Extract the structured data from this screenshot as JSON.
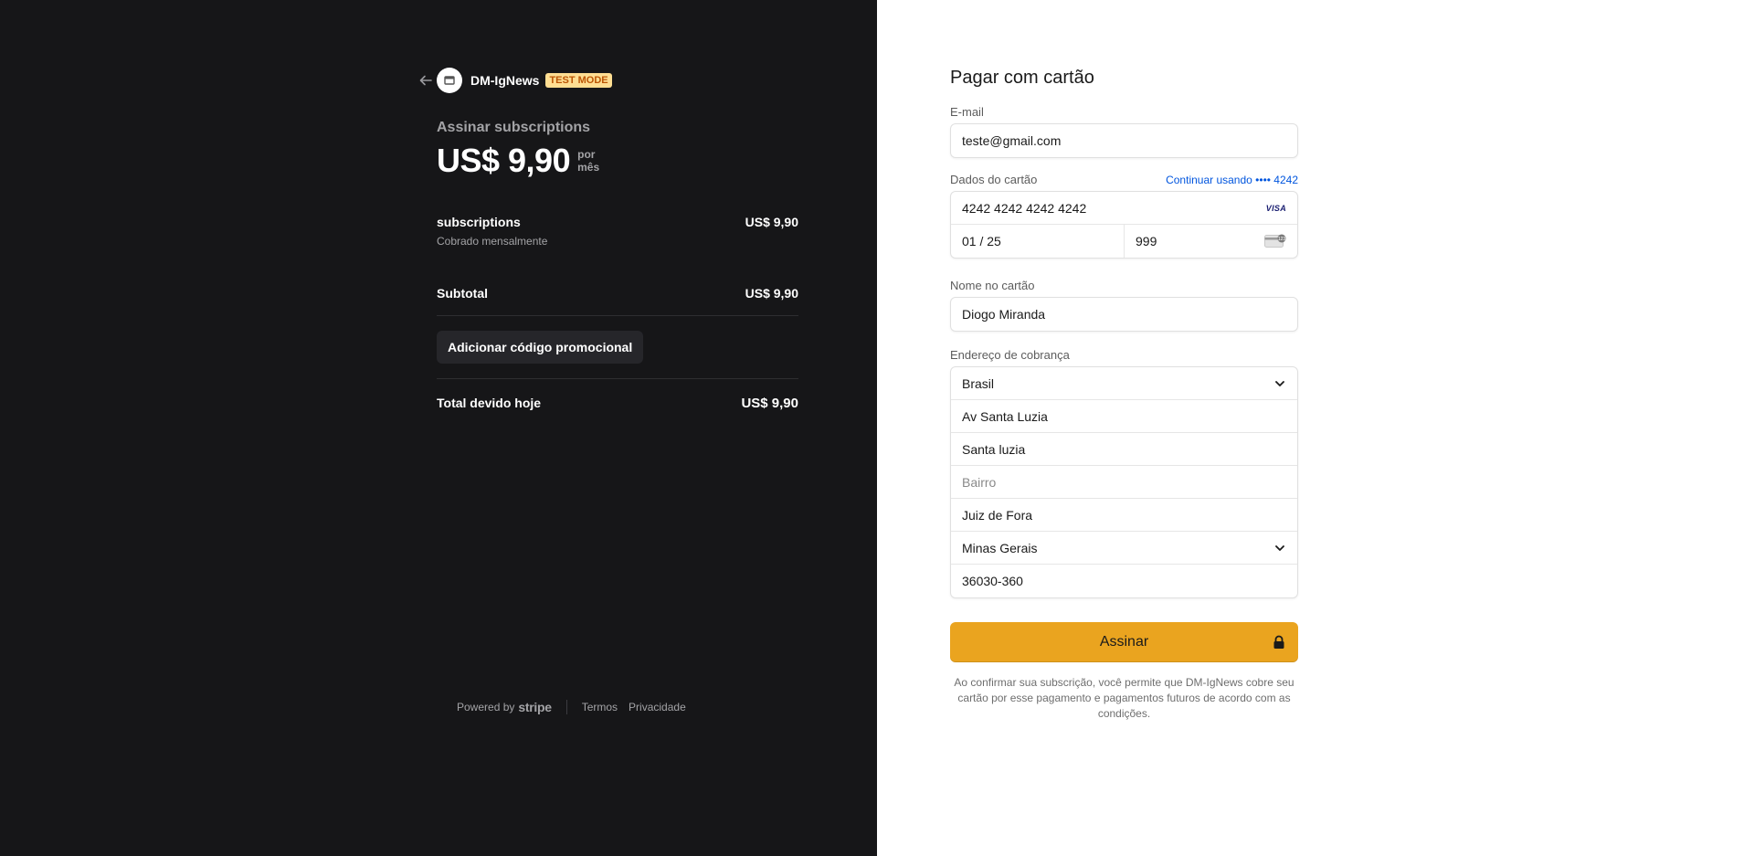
{
  "summary": {
    "brand_name": "DM-IgNews",
    "test_badge": "TEST MODE",
    "subscribe_title": "Assinar subscriptions",
    "price": "US$ 9,90",
    "per_1": "por",
    "per_2": "mês",
    "item": {
      "name": "subscriptions",
      "description": "Cobrado mensalmente",
      "price": "US$ 9,90"
    },
    "subtotal_label": "Subtotal",
    "subtotal_value": "US$ 9,90",
    "promo_button": "Adicionar código promocional",
    "total_label": "Total devido hoje",
    "total_value": "US$ 9,90"
  },
  "footer": {
    "powered_by": "Powered by",
    "stripe": "stripe",
    "terms": "Termos",
    "privacy": "Privacidade"
  },
  "form": {
    "title": "Pagar com cartão",
    "email_label": "E-mail",
    "email_value": "teste@gmail.com",
    "card_label": "Dados do cartão",
    "continue_link": "Continuar usando •••• 4242",
    "card_number": "4242 4242 4242 4242",
    "card_brand": "VISA",
    "expiry": "01 / 25",
    "cvc": "999",
    "name_label": "Nome no cartão",
    "name_value": "Diogo Miranda",
    "address_label": "Endereço de cobrança",
    "country": "Brasil",
    "address_line1": "Av Santa Luzia",
    "address_line2": "Santa luzia",
    "neighborhood_placeholder": "Bairro",
    "city": "Juiz de Fora",
    "state": "Minas Gerais",
    "postal_code": "36030-360",
    "submit_label": "Assinar",
    "terms_text": "Ao confirmar sua subscrição, você permite que DM-IgNews cobre seu cartão por esse pagamento e pagamentos futuros de acordo com as condições."
  },
  "colors": {
    "left_bg": "#161618",
    "accent_button": "#eaa41f",
    "badge_bg": "#ffde92",
    "link_blue": "#0055de"
  }
}
